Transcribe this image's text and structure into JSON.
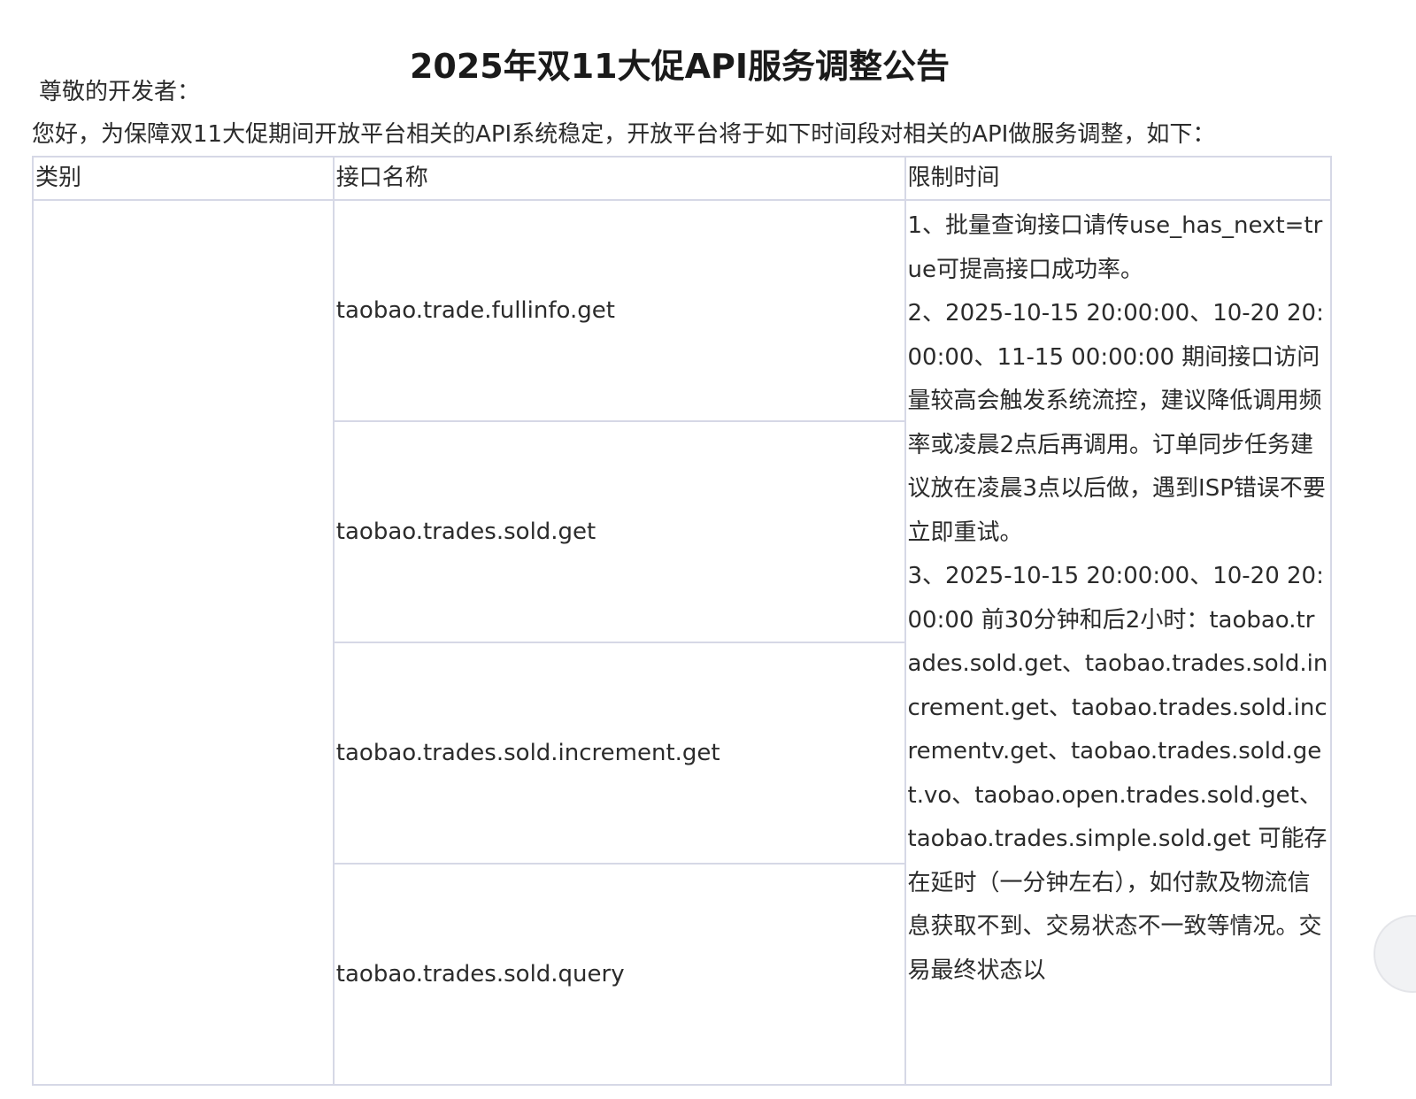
{
  "notice": {
    "title": "2025年双11大促API服务调整公告",
    "greeting": "尊敬的开发者：",
    "intro": "您好，为保障双11大促期间开放平台相关的API系统稳定，开放平台将于如下时间段对相关的API做服务调整，如下："
  },
  "table": {
    "headers": {
      "category": "类别",
      "api_name": "接口名称",
      "limit_time": "限制时间"
    },
    "category_value": "",
    "apis": [
      "taobao.trade.fullinfo.get",
      "taobao.trades.sold.get",
      "taobao.trades.sold.increment.get",
      "taobao.trades.sold.query"
    ],
    "limit_notes": [
      "1、批量查询接口请传use_has_next=true可提高接口成功率。",
      "2、2025-10-15 20:00:00、10-20 20:00:00、11-15 00:00:00 期间接口访问量较高会触发系统流控，建议降低调用频率或凌晨2点后再调用。订单同步任务建议放在凌晨3点以后做，遇到ISP错误不要立即重试。",
      "3、2025-10-15 20:00:00、10-20 20:00:00 前30分钟和后2小时：taobao.trades.sold.get、taobao.trades.sold.increment.get、taobao.trades.sold.incrementv.get、taobao.trades.sold.get.vo、taobao.open.trades.sold.get、taobao.trades.simple.sold.get 可能存在延时（一分钟左右），如付款及物流信息获取不到、交易状态不一致等情况。交易最终状态以"
    ]
  }
}
